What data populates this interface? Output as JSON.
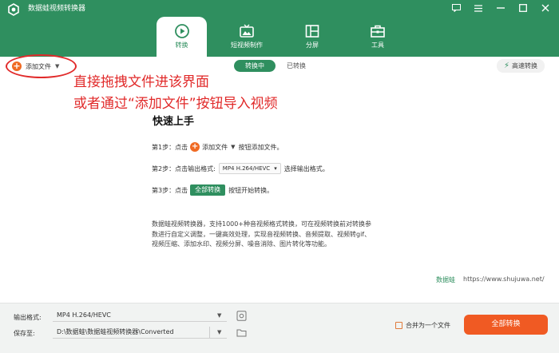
{
  "app": {
    "title": "数据蛙视频转换器"
  },
  "main_tabs": [
    {
      "label": "转换",
      "icon": "convert-icon",
      "active": true
    },
    {
      "label": "短视频制作",
      "icon": "tv-icon",
      "active": false
    },
    {
      "label": "分屏",
      "icon": "split-screen-icon",
      "active": false
    },
    {
      "label": "工具",
      "icon": "toolbox-icon",
      "active": false
    }
  ],
  "toolbar": {
    "add_file_label": "添加文件",
    "seg_converting": "转换中",
    "seg_converted": "已转换",
    "high_speed_label": "高速转换"
  },
  "annotation": {
    "line1": "直接拖拽文件进该界面",
    "line2": "或者通过“添加文件”按钮导入视频"
  },
  "quickstart": {
    "title": "快速上手",
    "step1_prefix": "第1步：点击",
    "step1_button": "添加文件",
    "step1_suffix": "按钮添加文件。",
    "step2_prefix": "第2步：点击输出格式:",
    "step2_format": "MP4 H.264/HEVC",
    "step2_suffix": "选择输出格式。",
    "step3_prefix": "第3步：点击",
    "step3_button": "全部转换",
    "step3_suffix": "按钮开始转换。"
  },
  "description": {
    "line1": "数据蛙视频转换器，支持1000+种音视频格式转换，可在视频转换前对转换参",
    "line2": "数进行自定义调整，一键高效处理，实现音视频转换、音频提取、视频转gif、",
    "line3": "视频压缩、添加水印、视频分屏、噪音消除、图片转化等功能。"
  },
  "footer": {
    "brand": "数据蛙",
    "url": "https://www.shujuwa.net/"
  },
  "bottom": {
    "output_label": "输出格式:",
    "output_value": "MP4 H.264/HEVC",
    "save_label": "保存至:",
    "save_value": "D:\\数据蛙\\数据蛙视频转换器\\Converted",
    "merge_label": "合并为一个文件",
    "convert_all": "全部转换"
  },
  "colors": {
    "brand_green": "#2f8f5f",
    "accent_orange": "#f05a23",
    "annotation_red": "#e12a2a"
  }
}
